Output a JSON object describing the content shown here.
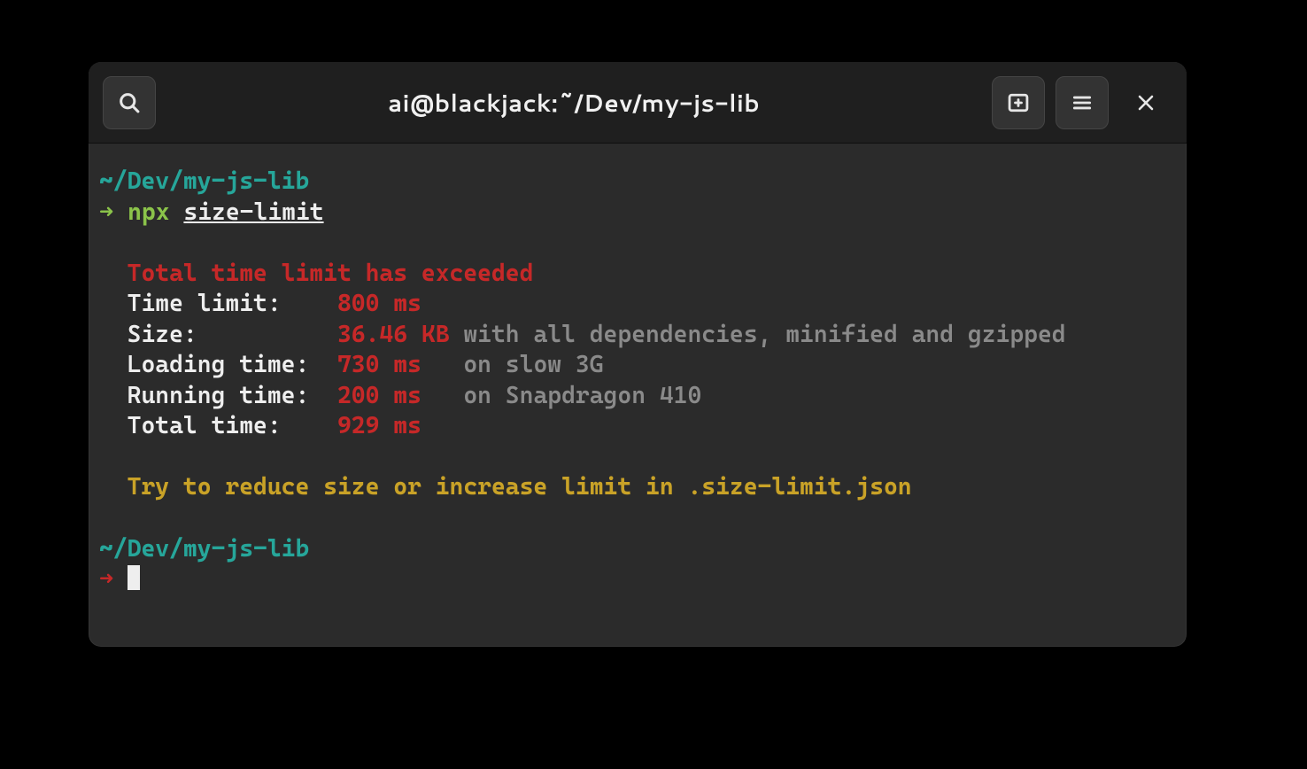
{
  "titlebar": {
    "title": "ai@blackjack:~/Dev/my-js-lib"
  },
  "terminal": {
    "cwd": "~/Dev/my-js-lib",
    "prompt_arrow": "➜",
    "cmd_bin": "npx",
    "cmd_arg": "size-limit",
    "error_header": "Total time limit has exceeded",
    "rows": {
      "time_limit": {
        "label": "Time limit:   ",
        "value": "800 ms",
        "note": ""
      },
      "size": {
        "label": "Size:         ",
        "value": "36.46 KB",
        "note": "with all dependencies, minified and gzipped"
      },
      "loading_time": {
        "label": "Loading time: ",
        "value": "730 ms",
        "note": "on slow 3G"
      },
      "running_time": {
        "label": "Running time: ",
        "value": "200 ms",
        "note": "on Snapdragon 410"
      },
      "total_time": {
        "label": "Total time:   ",
        "value": "929 ms",
        "note": ""
      }
    },
    "suggestion_prefix": "Try to reduce size or increase limit in ",
    "suggestion_file": ".size-limit.json"
  }
}
